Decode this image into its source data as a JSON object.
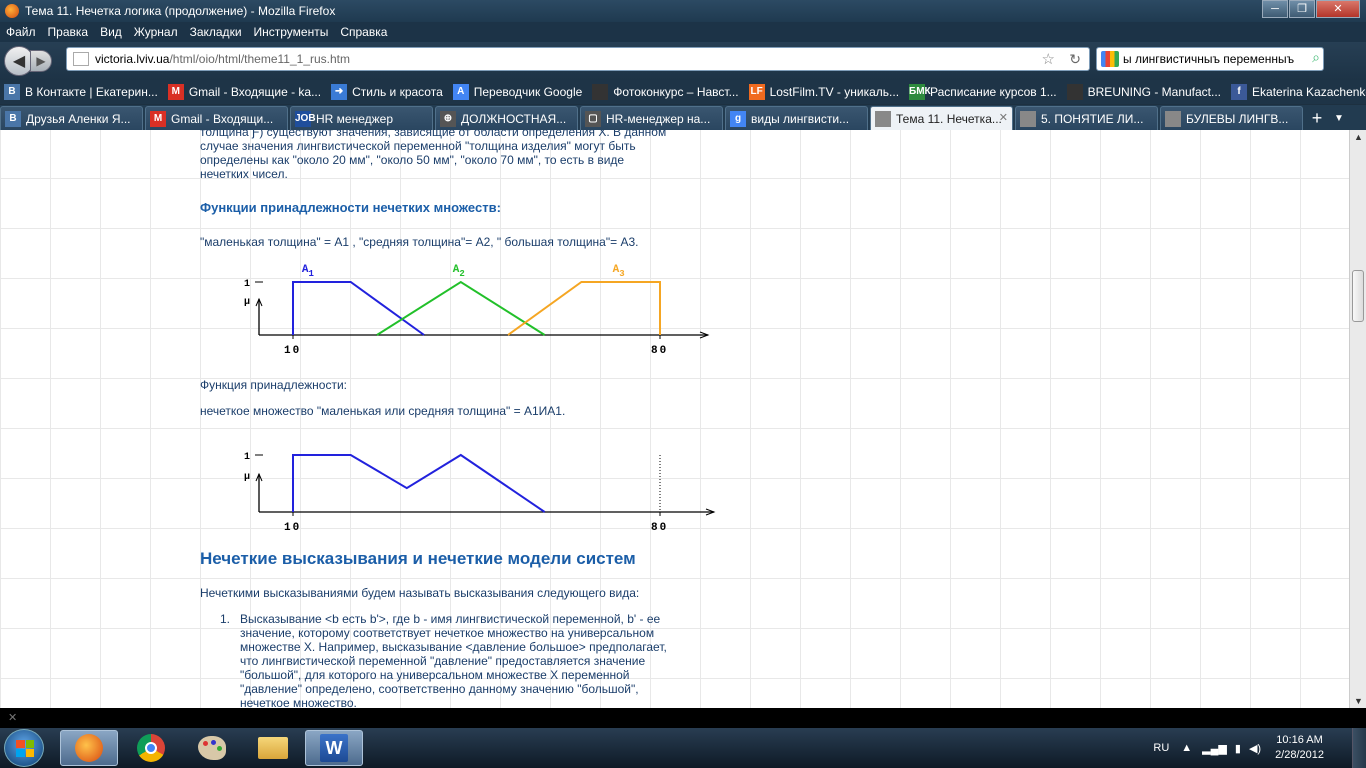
{
  "window": {
    "title": "Тема 11. Нечетка логика (продолжение) - Mozilla Firefox"
  },
  "menu": [
    "Файл",
    "Правка",
    "Вид",
    "Журнал",
    "Закладки",
    "Инструменты",
    "Справка"
  ],
  "nav": {
    "url_domain": "victoria.lviv.ua",
    "url_path": "/html/oio/html/theme11_1_rus.htm",
    "search_value": "ы лингвистичныъ переменныъ"
  },
  "bookmarks": [
    {
      "label": "В Контакте | Екатерин...",
      "icon": "vk-icon",
      "color": "#4a76a8",
      "glyph": "В"
    },
    {
      "label": "Gmail - Входящие - ka...",
      "icon": "gmail-icon",
      "color": "#d93025",
      "glyph": "M"
    },
    {
      "label": "Стиль и красота",
      "icon": "arrow-icon",
      "color": "#3a7bd5",
      "glyph": "➜"
    },
    {
      "label": "Переводчик Google",
      "icon": "translate-icon",
      "color": "#4285f4",
      "glyph": "A"
    },
    {
      "label": "Фотоконкурс – Навст...",
      "icon": "page-icon",
      "color": "#333",
      "glyph": " "
    },
    {
      "label": "LostFilm.TV - уникаль...",
      "icon": "lostfilm-icon",
      "color": "#f06a1f",
      "glyph": "LF"
    },
    {
      "label": "Расписание курсов 1...",
      "icon": "schedule-icon",
      "color": "#2d8a3e",
      "glyph": "БМК"
    },
    {
      "label": "BREUNING - Manufact...",
      "icon": "page-icon",
      "color": "#333",
      "glyph": " "
    },
    {
      "label": "Ekaterina Kazachenko",
      "icon": "facebook-icon",
      "color": "#3b5998",
      "glyph": "f"
    }
  ],
  "tabs": [
    {
      "label": "Друзья Аленки Я...",
      "icon": "vk-icon",
      "color": "#4a76a8",
      "glyph": "В",
      "active": false
    },
    {
      "label": "Gmail - Входящи...",
      "icon": "gmail-icon",
      "color": "#d93025",
      "glyph": "M",
      "active": false
    },
    {
      "label": "HR менеджер",
      "icon": "job-icon",
      "color": "#1f4e9c",
      "glyph": "JOB",
      "active": false
    },
    {
      "label": "ДОЛЖНОСТНАЯ...",
      "icon": "link-icon",
      "color": "#555",
      "glyph": "⊕",
      "active": false
    },
    {
      "label": "HR-менеджер на...",
      "icon": "speech-icon",
      "color": "#555",
      "glyph": "▢",
      "active": false
    },
    {
      "label": "виды лингвисти...",
      "icon": "google-icon",
      "color": "#4285f4",
      "glyph": "g",
      "active": false
    },
    {
      "label": "Тема 11. Нечетка...",
      "icon": "page-icon",
      "color": "#888",
      "glyph": " ",
      "active": true
    },
    {
      "label": "5. ПОНЯТИЕ ЛИ...",
      "icon": "page-icon",
      "color": "#888",
      "glyph": " ",
      "active": false
    },
    {
      "label": "БУЛЕВЫ ЛИНГВ...",
      "icon": "page-icon",
      "color": "#888",
      "glyph": " ",
      "active": false
    }
  ],
  "doc": {
    "intro_lines": [
      "толщина Ƒ) существуют значения, зависящие от области определения X. В данном",
      "случае значения лингвистической переменной \"толщина изделия\" могут быть",
      "определены как \"около 20 мм\", \"около 50 мм\", \"около 70 мм\", то есть в виде",
      "нечетких чисел."
    ],
    "membership_heading": "Функции принадлежности нечетких множеств:",
    "sets_line": "\"маленькая толщина\" = А1 , \"средняя толщина\"= А2, \" большая толщина\"= А3.",
    "func_label": "Функция принадлежности:",
    "union_line": "нечеткое множество \"маленькая или средняя толщина\" = А1ИА1.",
    "section_title": "Нечеткие высказывания и нечеткие модели систем",
    "section_intro": "Нечеткими высказываниями будем называть высказывания следующего вида:",
    "item1_number": "1.",
    "item1_lines": [
      "Высказывание <b есть b'>, где b - имя лингвистической переменной, b' - ее",
      "значение, которому соответствует нечеткое множество на универсальном",
      "множестве X. Например, высказывание <давление большое> предполагает,",
      "что лингвистической переменной \"давление\" предоставляется значение",
      "\"большой\", для которого на универсальном множестве X переменной",
      "\"давление\" определено, соответственно данному значению \"большой\",",
      "нечеткое множество."
    ]
  },
  "chart_data": [
    {
      "type": "line",
      "ylabel": "μ",
      "ytick": "1",
      "xticks": [
        "10",
        "80"
      ],
      "series": [
        {
          "name": "A1",
          "color": "#2222dd",
          "points": [
            [
              10,
              0
            ],
            [
              10,
              1
            ],
            [
              21,
              1
            ],
            [
              35,
              0
            ]
          ]
        },
        {
          "name": "A2",
          "color": "#22c02a",
          "points": [
            [
              26,
              0
            ],
            [
              42,
              1
            ],
            [
              58,
              0
            ]
          ]
        },
        {
          "name": "A3",
          "color": "#f5a623",
          "points": [
            [
              51,
              0
            ],
            [
              65,
              1
            ],
            [
              80,
              1
            ],
            [
              80,
              0
            ]
          ]
        }
      ]
    },
    {
      "type": "line",
      "ylabel": "μ",
      "ytick": "1",
      "xticks": [
        "10",
        "80"
      ],
      "series": [
        {
          "name": "",
          "color": "#2222dd",
          "points": [
            [
              10,
              0
            ],
            [
              10,
              1
            ],
            [
              21,
              1
            ],
            [
              31.7,
              0.42
            ],
            [
              42,
              1
            ],
            [
              58,
              0
            ]
          ]
        }
      ]
    }
  ],
  "taskbar": {
    "lang": "RU",
    "time": "10:16 AM",
    "date": "2/28/2012"
  }
}
